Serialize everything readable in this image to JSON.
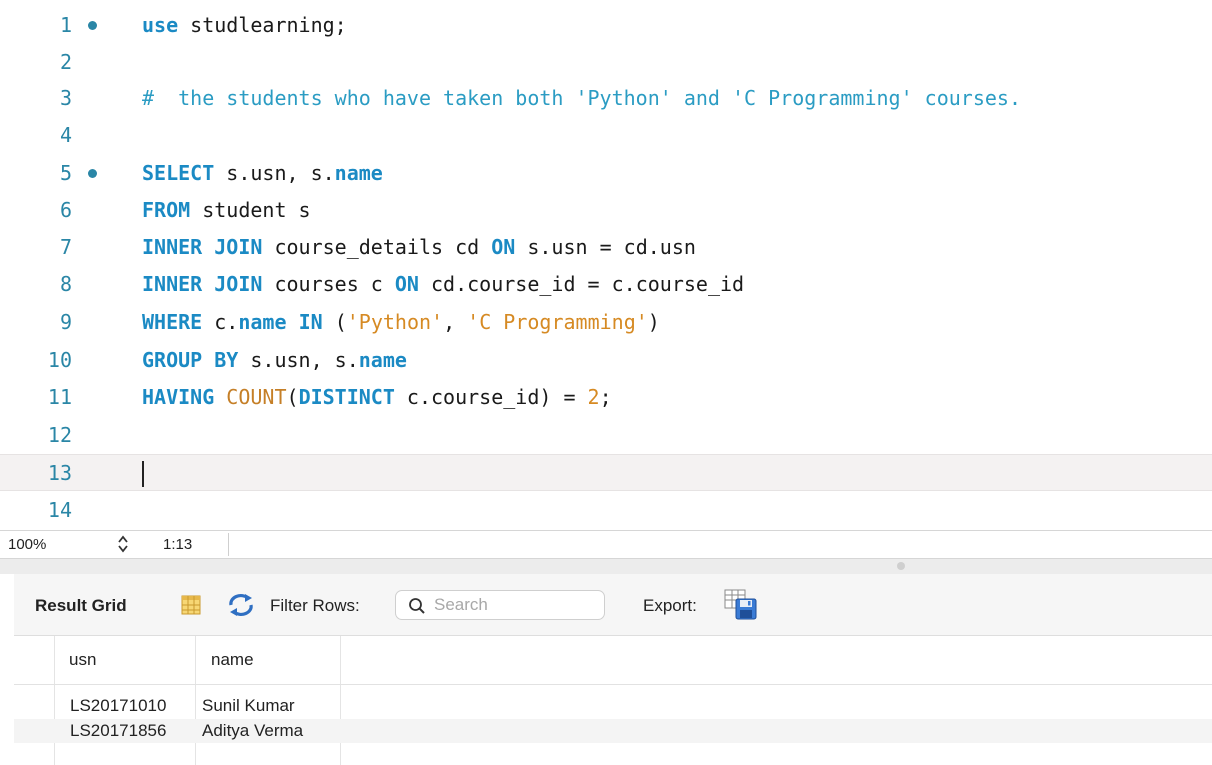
{
  "editor": {
    "line_numbers": [
      "1",
      "2",
      "3",
      "4",
      "5",
      "6",
      "7",
      "8",
      "9",
      "10",
      "11",
      "12",
      "13",
      "14"
    ],
    "lines": [
      {
        "kw1": "use",
        "rest": " studlearning;"
      },
      {},
      {
        "comment": "#  the students who have taken both 'Python' and 'C Programming' courses."
      },
      {},
      {
        "kw1": "SELECT",
        "t1": " s.usn, s.",
        "kw2": "name"
      },
      {
        "kw1": "FROM",
        "t1": " student s"
      },
      {
        "kw1": "INNER JOIN",
        "t1": " course_details cd ",
        "kw2": "ON",
        "t2": " s.usn = cd.usn"
      },
      {
        "kw1": "INNER JOIN",
        "t1": " courses c ",
        "kw2": "ON",
        "t2": " cd.course_id = c.course_id"
      },
      {
        "kw1": "WHERE",
        "t1": " c.",
        "kw2": "name",
        "t2": " ",
        "kw3": "IN",
        "t3": " (",
        "s1": "'Python'",
        "t4": ", ",
        "s2": "'C Programming'",
        "t5": ")"
      },
      {
        "kw1": "GROUP BY",
        "t1": " s.usn, s.",
        "kw2": "name"
      },
      {
        "kw1": "HAVING",
        "t1": " ",
        "fn": "COUNT",
        "t2": "(",
        "kw2": "DISTINCT",
        "t3": " c.course_id) = ",
        "num": "2",
        "t4": ";"
      }
    ]
  },
  "status": {
    "zoom": "100%",
    "cursor": "1:13"
  },
  "result_toolbar": {
    "title": "Result Grid",
    "filter_label": "Filter Rows:",
    "search_placeholder": "Search",
    "export_label": "Export:"
  },
  "grid": {
    "columns": [
      "usn",
      "name"
    ],
    "rows": [
      [
        "LS20171010",
        "Sunil Kumar"
      ],
      [
        "LS20171856",
        "Aditya Verma"
      ]
    ]
  },
  "icons": {
    "breakpoint": "statement-marker-dot-icon",
    "zoom_stepper": "up-down-stepper-icon",
    "grid": "grid-columns-icon",
    "refresh": "refresh-icon",
    "search": "search-icon",
    "export": "export-save-icon"
  },
  "colors": {
    "keyword": "#1b8ac4",
    "string": "#d68a23",
    "comment": "#2b9cc3",
    "line_number": "#2a86a6"
  }
}
